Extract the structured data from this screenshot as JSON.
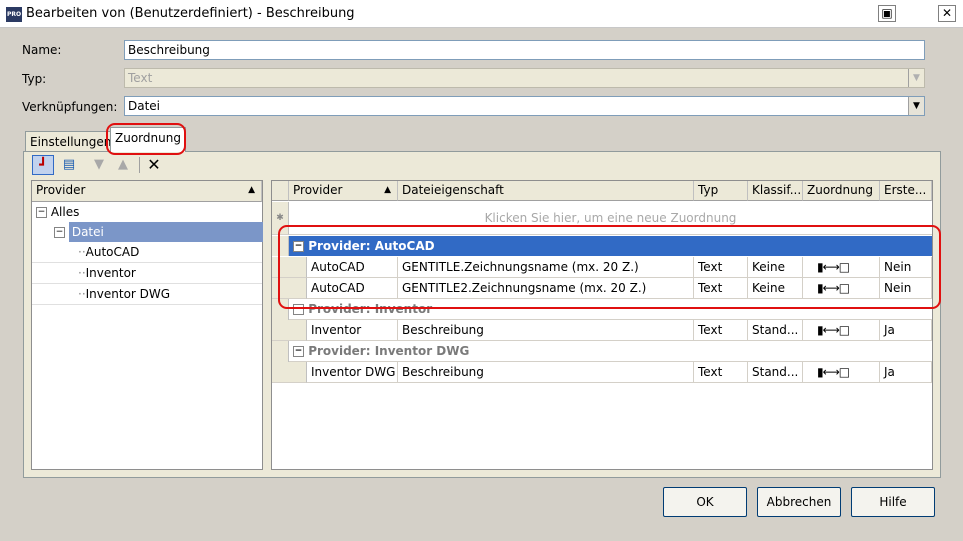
{
  "window": {
    "title": "Bearbeiten von (Benutzerdefiniert) - Beschreibung",
    "app_icon_text": "PRO"
  },
  "form": {
    "name_label": "Name:",
    "name_value": "Beschreibung",
    "type_label": "Typ:",
    "type_value": "Text",
    "links_label": "Verknüpfungen:",
    "links_value": "Datei"
  },
  "tabs": [
    {
      "label": "Einstellungen",
      "active": false
    },
    {
      "label": "Zuordnung",
      "active": true
    }
  ],
  "toolbar": {
    "icons": [
      "tree-view-icon",
      "list-view-icon",
      "move-down-icon",
      "move-up-icon",
      "delete-icon"
    ]
  },
  "tree": {
    "header": "Provider",
    "nodes": [
      {
        "label": "Alles",
        "level": 0,
        "expandable": true
      },
      {
        "label": "Datei",
        "level": 1,
        "expandable": true,
        "selected": true
      },
      {
        "label": "AutoCAD",
        "level": 2
      },
      {
        "label": "Inventor",
        "level": 2
      },
      {
        "label": "Inventor DWG",
        "level": 2
      }
    ]
  },
  "grid": {
    "columns": [
      "Provider",
      "Dateieigenschaft",
      "Typ",
      "Klassif...",
      "Zuordnung",
      "Erste..."
    ],
    "new_row_hint": "Klicken Sie hier, um eine neue Zuordnung",
    "groups": [
      {
        "label": "Provider: AutoCAD",
        "selected": true,
        "rows": [
          {
            "provider": "AutoCAD",
            "property": "GENTITLE.Zeichnungsname (mx. 20 Z.)",
            "type": "Text",
            "class": "Keine",
            "create": "Nein"
          },
          {
            "provider": "AutoCAD",
            "property": "GENTITLE2.Zeichnungsname (mx. 20 Z.)",
            "type": "Text",
            "class": "Keine",
            "create": "Nein"
          }
        ]
      },
      {
        "label": "Provider: Inventor",
        "selected": false,
        "rows": [
          {
            "provider": "Inventor",
            "property": "Beschreibung",
            "type": "Text",
            "class": "Stand...",
            "create": "Ja"
          }
        ]
      },
      {
        "label": "Provider: Inventor DWG",
        "selected": false,
        "rows": [
          {
            "provider": "Inventor DWG",
            "property": "Beschreibung",
            "type": "Text",
            "class": "Stand...",
            "create": "Ja"
          }
        ]
      }
    ]
  },
  "buttons": {
    "ok": "OK",
    "cancel": "Abbrechen",
    "help": "Hilfe"
  },
  "colors": {
    "selection": "#316ac5",
    "highlight_annotation": "#e01010"
  }
}
